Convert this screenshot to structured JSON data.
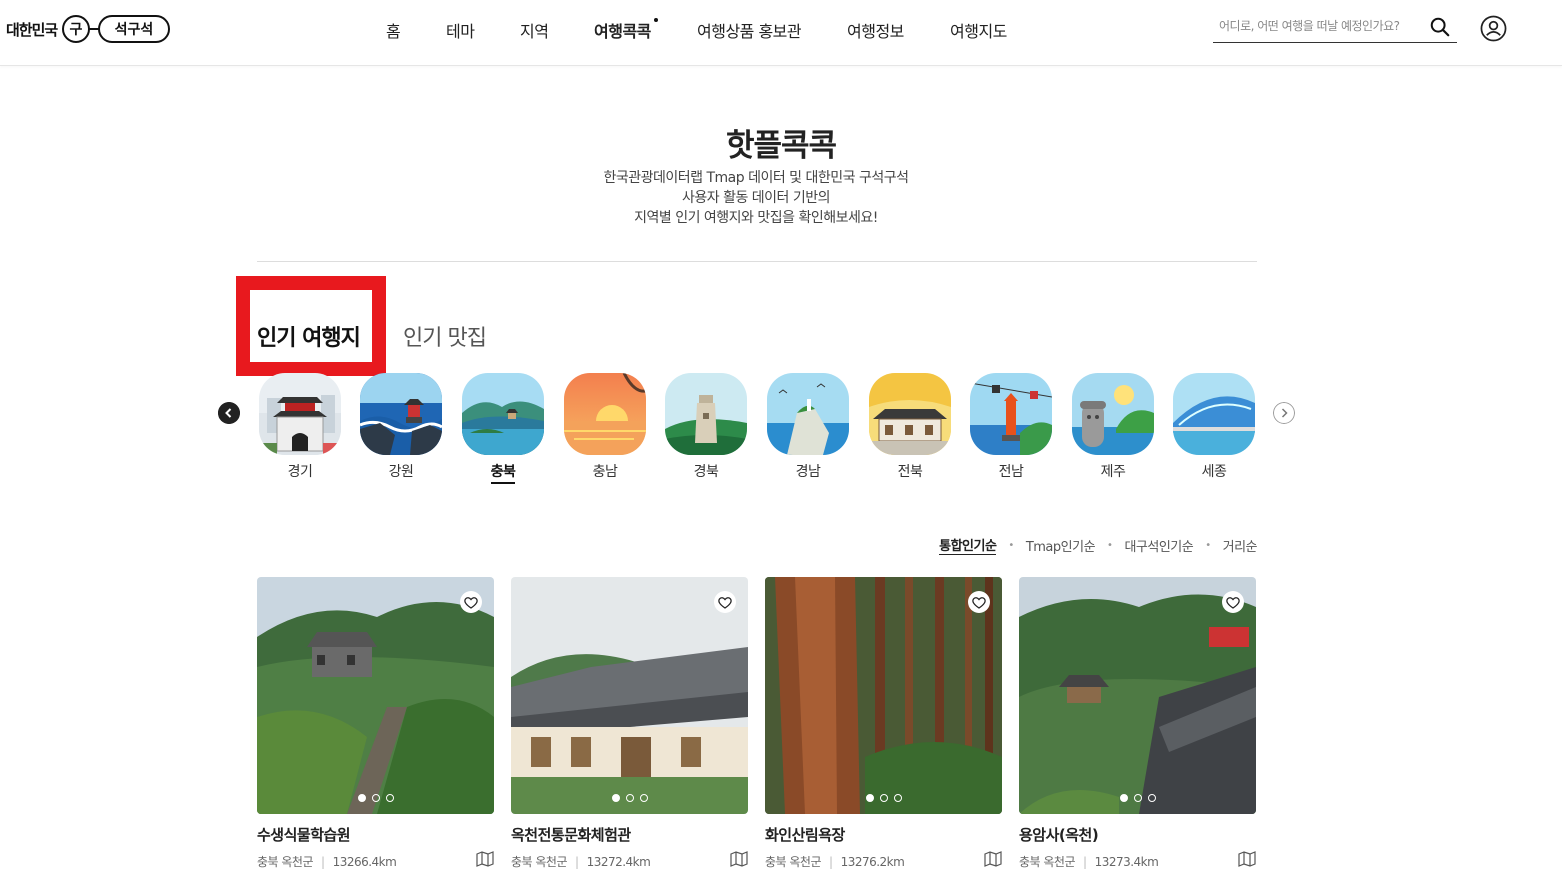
{
  "header": {
    "logo_text": "대한민국",
    "logo_mark": "구석구석",
    "nav": [
      {
        "label": "홈",
        "active": false
      },
      {
        "label": "테마",
        "active": false
      },
      {
        "label": "지역",
        "active": false
      },
      {
        "label": "여행콕콕",
        "active": true
      },
      {
        "label": "여행상품 홍보관",
        "active": false
      },
      {
        "label": "여행정보",
        "active": false
      },
      {
        "label": "여행지도",
        "active": false
      }
    ],
    "search_placeholder": "어디로, 어떤 여행을 떠날 예정인가요?",
    "icons": {
      "search": "search-icon",
      "user": "user-icon"
    }
  },
  "page": {
    "title": "핫플콕콕",
    "subtitle_lines": [
      "한국관광데이터랩 Tmap 데이터 및 대한민국 구석구석",
      "사용자 활동 데이터 기반의",
      "지역별 인기 여행지와 맛집을 확인해보세요!"
    ]
  },
  "tabs": [
    {
      "label": "인기 여행지",
      "active": true
    },
    {
      "label": "인기 맛집",
      "active": false
    }
  ],
  "regions": [
    {
      "label": "경기",
      "active": false
    },
    {
      "label": "강원",
      "active": false
    },
    {
      "label": "충북",
      "active": true
    },
    {
      "label": "충남",
      "active": false
    },
    {
      "label": "경북",
      "active": false
    },
    {
      "label": "경남",
      "active": false
    },
    {
      "label": "전북",
      "active": false
    },
    {
      "label": "전남",
      "active": false
    },
    {
      "label": "제주",
      "active": false
    },
    {
      "label": "세종",
      "active": false
    }
  ],
  "sort": [
    {
      "label": "통합인기순",
      "active": true
    },
    {
      "label": "Tmap인기순",
      "active": false
    },
    {
      "label": "대구석인기순",
      "active": false
    },
    {
      "label": "거리순",
      "active": false
    }
  ],
  "cards": [
    {
      "title": "수생식물학습원",
      "region": "충북 옥천군",
      "distance": "13266.4km"
    },
    {
      "title": "옥천전통문화체험관",
      "region": "충북 옥천군",
      "distance": "13272.4km"
    },
    {
      "title": "화인산림욕장",
      "region": "충북 옥천군",
      "distance": "13276.2km"
    },
    {
      "title": "용암사(옥천)",
      "region": "충북 옥천군",
      "distance": "13273.4km"
    }
  ],
  "colors": {
    "highlight_box": "#e8191e",
    "text": "#222222"
  }
}
